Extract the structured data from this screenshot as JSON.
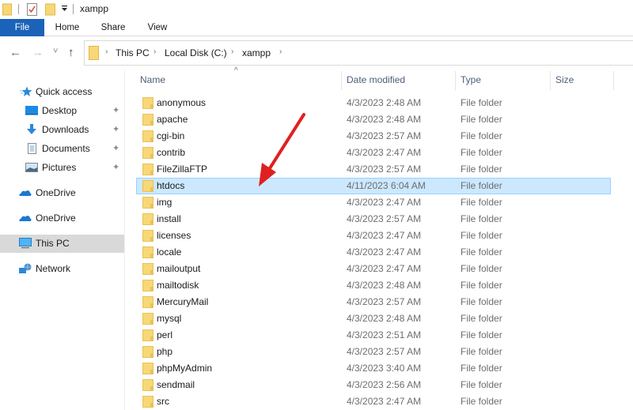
{
  "window": {
    "title": "xampp"
  },
  "quick_access_toolbar": {
    "icons": [
      "folder-icon",
      "properties-icon",
      "new-folder-icon",
      "customize-dropdown-icon"
    ]
  },
  "ribbon": {
    "tabs": [
      {
        "label": "File",
        "active": true
      },
      {
        "label": "Home"
      },
      {
        "label": "Share"
      },
      {
        "label": "View"
      }
    ]
  },
  "navigation": {
    "back": "←",
    "forward": "→",
    "recent": "˅",
    "up": "↑",
    "breadcrumb": [
      "This PC",
      "Local Disk (C:)",
      "xampp"
    ],
    "separator": "›"
  },
  "sidebar": {
    "items": [
      {
        "label": "Quick access",
        "icon": "star-icon"
      },
      {
        "label": "Desktop",
        "icon": "desktop-icon",
        "pinned": true
      },
      {
        "label": "Downloads",
        "icon": "downloads-icon",
        "pinned": true
      },
      {
        "label": "Documents",
        "icon": "documents-icon",
        "pinned": true
      },
      {
        "label": "Pictures",
        "icon": "pictures-icon",
        "pinned": true
      },
      {
        "label": "OneDrive",
        "icon": "onedrive-icon"
      },
      {
        "label": "OneDrive",
        "icon": "onedrive-icon"
      },
      {
        "label": "This PC",
        "icon": "this-pc-icon",
        "selected": true
      },
      {
        "label": "Network",
        "icon": "network-icon"
      }
    ],
    "pin_glyph": "📌"
  },
  "columns": {
    "name": "Name",
    "date": "Date modified",
    "type": "Type",
    "size": "Size",
    "sort_indicator": "^"
  },
  "files": [
    {
      "name": "anonymous",
      "date": "4/3/2023 2:48 AM",
      "type": "File folder"
    },
    {
      "name": "apache",
      "date": "4/3/2023 2:48 AM",
      "type": "File folder"
    },
    {
      "name": "cgi-bin",
      "date": "4/3/2023 2:57 AM",
      "type": "File folder"
    },
    {
      "name": "contrib",
      "date": "4/3/2023 2:47 AM",
      "type": "File folder"
    },
    {
      "name": "FileZillaFTP",
      "date": "4/3/2023 2:57 AM",
      "type": "File folder"
    },
    {
      "name": "htdocs",
      "date": "4/11/2023 6:04 AM",
      "type": "File folder",
      "selected": true
    },
    {
      "name": "img",
      "date": "4/3/2023 2:47 AM",
      "type": "File folder"
    },
    {
      "name": "install",
      "date": "4/3/2023 2:57 AM",
      "type": "File folder"
    },
    {
      "name": "licenses",
      "date": "4/3/2023 2:47 AM",
      "type": "File folder"
    },
    {
      "name": "locale",
      "date": "4/3/2023 2:47 AM",
      "type": "File folder"
    },
    {
      "name": "mailoutput",
      "date": "4/3/2023 2:47 AM",
      "type": "File folder"
    },
    {
      "name": "mailtodisk",
      "date": "4/3/2023 2:48 AM",
      "type": "File folder"
    },
    {
      "name": "MercuryMail",
      "date": "4/3/2023 2:57 AM",
      "type": "File folder"
    },
    {
      "name": "mysql",
      "date": "4/3/2023 2:48 AM",
      "type": "File folder"
    },
    {
      "name": "perl",
      "date": "4/3/2023 2:51 AM",
      "type": "File folder"
    },
    {
      "name": "php",
      "date": "4/3/2023 2:57 AM",
      "type": "File folder"
    },
    {
      "name": "phpMyAdmin",
      "date": "4/3/2023 3:40 AM",
      "type": "File folder"
    },
    {
      "name": "sendmail",
      "date": "4/3/2023 2:56 AM",
      "type": "File folder"
    },
    {
      "name": "src",
      "date": "4/3/2023 2:47 AM",
      "type": "File folder"
    }
  ],
  "annotation": {
    "type": "arrow",
    "color": "#e02020",
    "points_to": "htdocs"
  },
  "colors": {
    "file_tab": "#1b63b8",
    "selection_bg": "#cce8ff",
    "selection_border": "#99d1ff",
    "sidebar_selected": "#d9d9d9",
    "folder": "#f8d775"
  }
}
